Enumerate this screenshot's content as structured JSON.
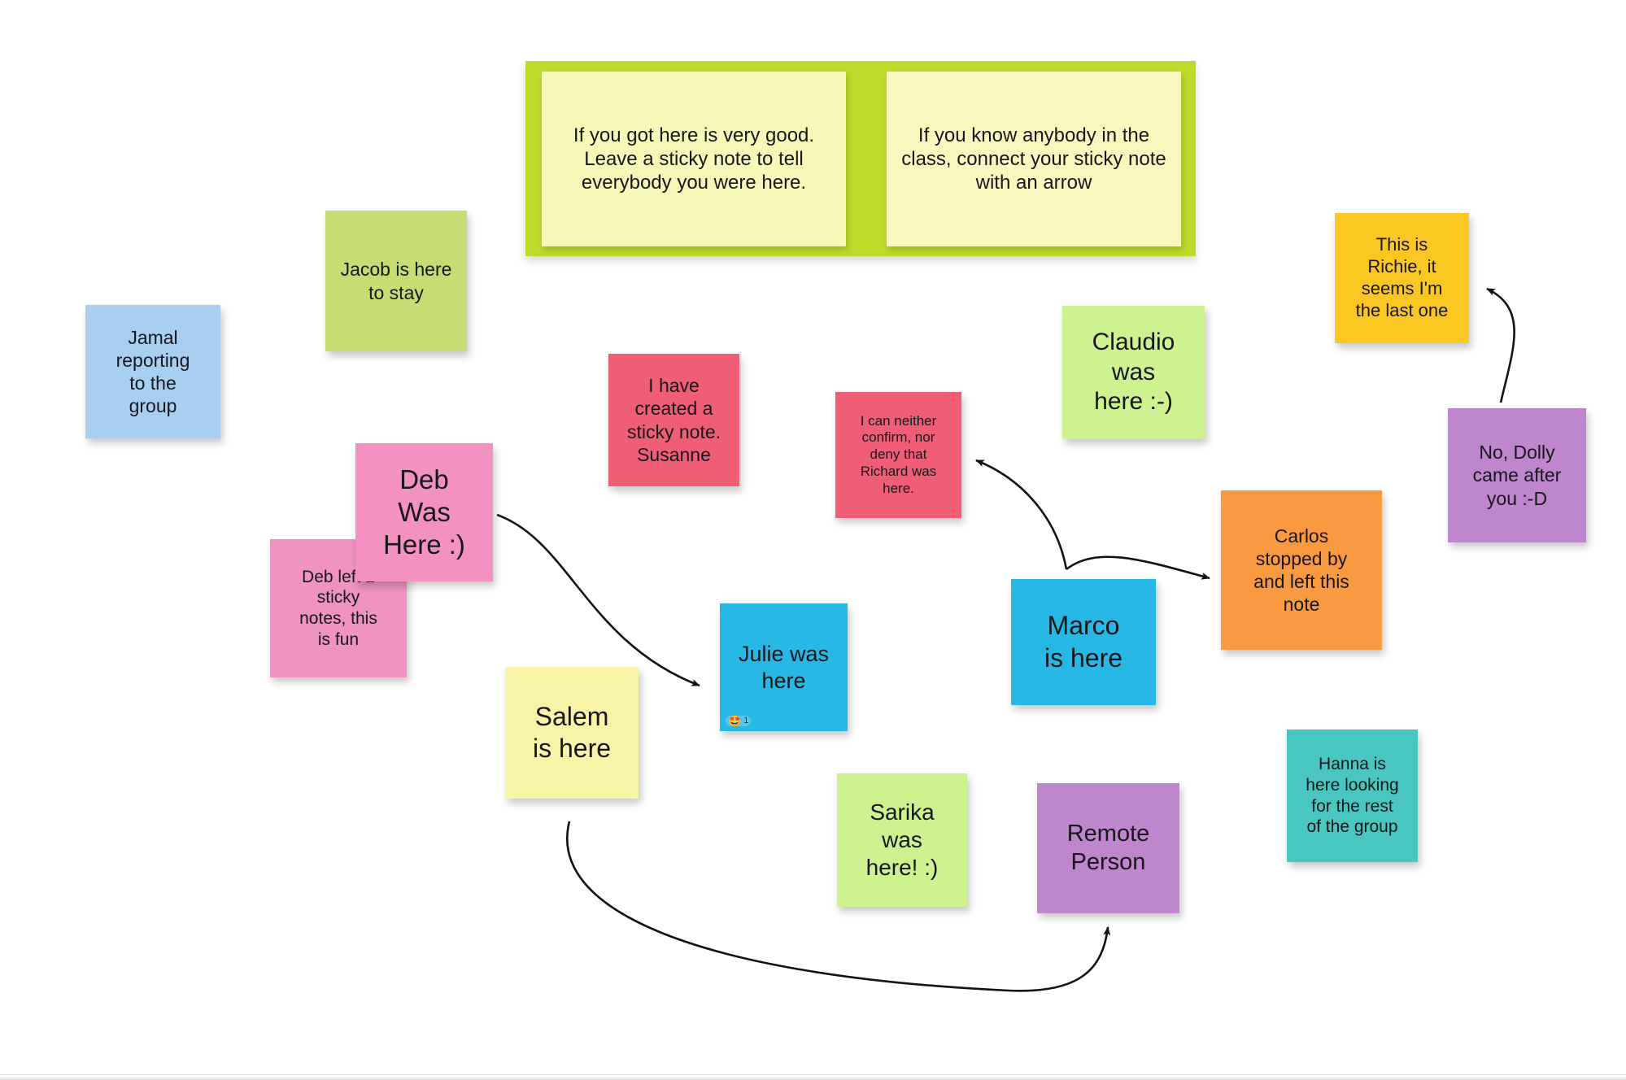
{
  "board": {
    "background_color": "#ffffff",
    "instruction_panel_color": "#bedb2c"
  },
  "instructions": [
    {
      "id": "instruction-got-here",
      "text": "If you got here is very good.\nLeave a sticky note to tell everybody you were here.",
      "color": "#f7f7b8"
    },
    {
      "id": "instruction-connect-arrow",
      "text": "If you know anybody in the class, connect your sticky note with an arrow",
      "color": "#f9f7bd"
    }
  ],
  "notes": [
    {
      "id": "note-jamal",
      "text": "Jamal\nreporting\nto the\ngroup",
      "color": "#a8cef0",
      "font_size": 23
    },
    {
      "id": "note-jacob",
      "text": "Jacob is here\nto stay",
      "color": "#c6dd74",
      "font_size": 23
    },
    {
      "id": "note-deb-was-here",
      "text": "Deb\nWas\nHere :)",
      "color": "#f291c2",
      "font_size": 33
    },
    {
      "id": "note-deb-left-two",
      "text": "Deb left 2\nsticky\nnotes, this\nis fun",
      "color": "#ef93c3",
      "font_size": 21
    },
    {
      "id": "note-susanne",
      "text": "I have\ncreated a\nsticky note.\nSusanne",
      "color": "#ef5e74",
      "font_size": 23
    },
    {
      "id": "note-richard",
      "text": "I can neither\nconfirm, nor\ndeny that\nRichard was\nhere.",
      "color": "#ef5e74",
      "font_size": 17
    },
    {
      "id": "note-claudio",
      "text": "Claudio\nwas\nhere :-)",
      "color": "#cdf290",
      "font_size": 30
    },
    {
      "id": "note-richie",
      "text": "This is\nRichie, it\nseems I'm\nthe last one",
      "color": "#fbc823",
      "font_size": 22
    },
    {
      "id": "note-dolly",
      "text": "No, Dolly\ncame after\nyou :-D",
      "color": "#bd86cd",
      "font_size": 23
    },
    {
      "id": "note-carlos",
      "text": "Carlos\nstopped by\nand left this\nnote",
      "color": "#f99a41",
      "font_size": 23
    },
    {
      "id": "note-julie",
      "text": "Julie was\nhere",
      "color": "#27b8e6",
      "font_size": 27,
      "reaction": {
        "emoji": "🤩",
        "count": "1"
      }
    },
    {
      "id": "note-marco",
      "text": "Marco\nis here",
      "color": "#27b8e6",
      "font_size": 32
    },
    {
      "id": "note-salem",
      "text": "Salem\nis here",
      "color": "#f9f3a8",
      "font_size": 32
    },
    {
      "id": "note-sarika",
      "text": "Sarika\nwas\nhere! :)",
      "color": "#cdf290",
      "font_size": 28
    },
    {
      "id": "note-remote-person",
      "text": "Remote\nPerson",
      "color": "#bd86cd",
      "font_size": 29
    },
    {
      "id": "note-hanna",
      "text": "Hanna is\nhere looking\nfor the rest\nof the group",
      "color": "#4ac6c0",
      "font_size": 21
    }
  ],
  "connections": [
    {
      "id": "arrow-deb-to-julie",
      "from": "note-deb-was-here",
      "to": "note-julie"
    },
    {
      "id": "arrow-salem-to-remote-person",
      "from": "note-salem",
      "to": "note-remote-person"
    },
    {
      "id": "arrow-marco-to-richard",
      "from": "note-marco",
      "to": "note-richard"
    },
    {
      "id": "arrow-marco-to-carlos",
      "from": "note-marco",
      "to": "note-carlos"
    },
    {
      "id": "arrow-dolly-to-richie",
      "from": "note-dolly",
      "to": "note-richie"
    }
  ]
}
